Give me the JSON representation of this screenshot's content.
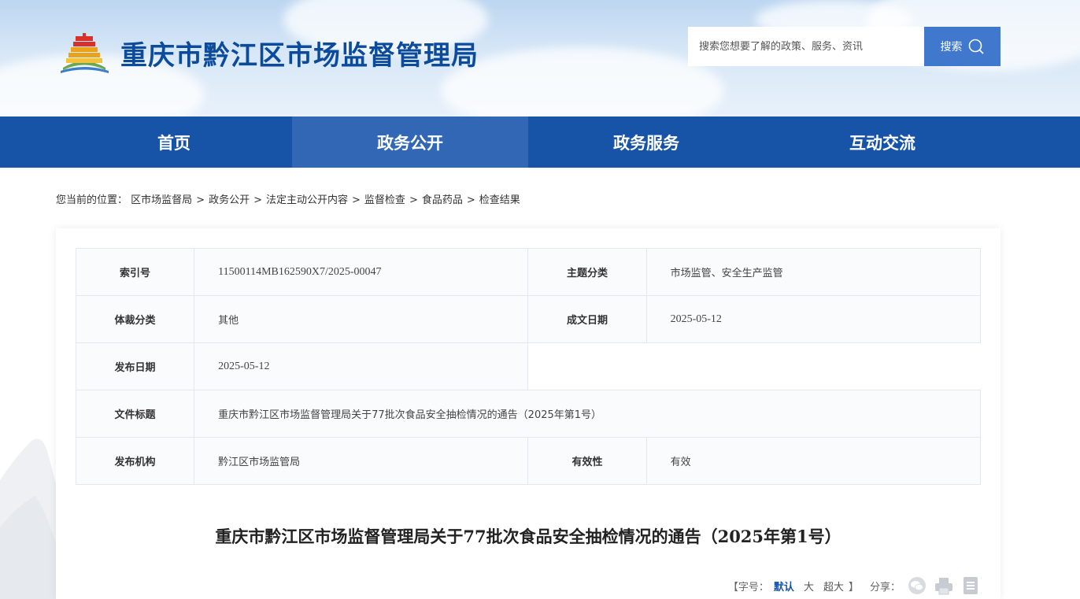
{
  "header": {
    "site_title": "重庆市黔江区市场监督管理局",
    "search_placeholder": "搜索您想要了解的政策、服务、资讯",
    "search_button": "搜索"
  },
  "nav": {
    "items": [
      {
        "label": "首页"
      },
      {
        "label": "政务公开"
      },
      {
        "label": "政务服务"
      },
      {
        "label": "互动交流"
      }
    ],
    "active_index": 1
  },
  "breadcrumb": {
    "prefix": "您当前的位置：",
    "items": [
      "区市场监督局",
      "政务公开",
      "法定主动公开内容",
      "监督检查",
      "食品药品",
      "检查结果"
    ],
    "separator": ">"
  },
  "meta": {
    "index_label": "索引号",
    "index_value": "11500114MB162590X7/2025-00047",
    "topic_label": "主题分类",
    "topic_value": "市场监管、安全生产监管",
    "genre_label": "体裁分类",
    "genre_value": "其他",
    "written_label": "成文日期",
    "written_value": "2025-05-12",
    "publish_label": "发布日期",
    "publish_value": "2025-05-12",
    "doc_title_label": "文件标题",
    "doc_title_value": "重庆市黔江区市场监督管理局关于77批次食品安全抽检情况的通告（2025年第1号）",
    "issuer_label": "发布机构",
    "issuer_value": "黔江区市场监管局",
    "validity_label": "有效性",
    "validity_value": "有效"
  },
  "article": {
    "title": "重庆市黔江区市场监督管理局关于77批次食品安全抽检情况的通告（2025年第1号）"
  },
  "toolbar": {
    "open_bracket": "【",
    "font_size_label": "字号：",
    "size_default": "默认",
    "size_large": "大",
    "size_xlarge": "超大",
    "close_bracket": "】",
    "share_label": "分享：",
    "icons": [
      "wechat-icon",
      "print-icon",
      "document-icon"
    ]
  },
  "colors": {
    "nav_bg": "#1753a6",
    "nav_active": "#3167b5",
    "title_blue": "#0c4b9c",
    "search_button": "#3f78cc"
  }
}
